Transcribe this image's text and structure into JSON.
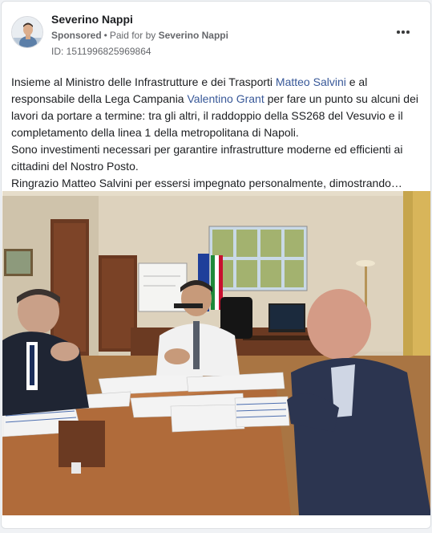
{
  "post": {
    "author_name": "Severino Nappi",
    "sponsored_label": "Sponsored",
    "separator": "•",
    "paid_for_prefix": "Paid for by",
    "paid_for_name": "Severino Nappi",
    "ad_id": "ID: 1511996825969864",
    "body": {
      "p1_a": "Insieme al Ministro delle Infrastrutture e dei Trasporti ",
      "link1": "Matteo Salvini",
      "p1_b": " e al responsabile della Lega Campania ",
      "link2": "Valentino Grant",
      "p1_c": " per fare un punto su alcuni dei lavori da portare a termine: tra gli altri, il raddoppio della SS268 del Vesuvio e il completamento della linea 1 della metropolitana di Napoli.",
      "p2": "Sono investimenti necessari per garantire infrastrutture moderne ed efficienti ai cittadini del Nostro Posto.",
      "p3": "Ringrazio Matteo Salvini per essersi impegnato personalmente, dimostrando…"
    }
  },
  "icons": {
    "more": "more-horizontal-icon",
    "avatar": "profile-photo"
  },
  "colors": {
    "link": "#385898",
    "secondary_text": "#65676b",
    "primary_text": "#1c1e21"
  }
}
